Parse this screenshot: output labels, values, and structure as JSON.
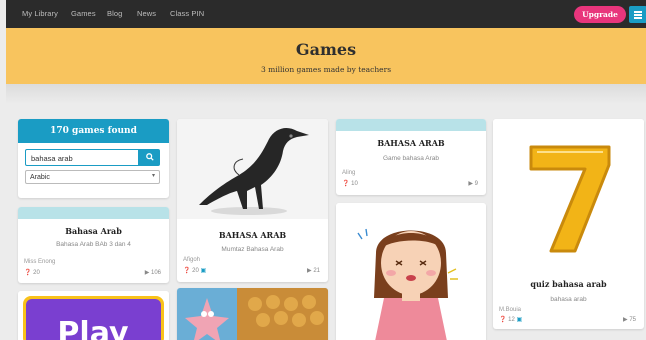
{
  "nav": {
    "links": [
      "My Library",
      "Games",
      "Blog",
      "News",
      "Class PIN"
    ],
    "upgrade_label": "Upgrade"
  },
  "hero": {
    "title": "Games",
    "subtitle": "3 million games made by teachers"
  },
  "filter": {
    "found_label": "170 games found",
    "search_value": "bahasa arab",
    "language_value": "Arabic"
  },
  "cards": [
    {
      "title": "Bahasa Arab",
      "subtitle": "Bahasa Arab BAb 3 dan 4",
      "author": "Miss Enong",
      "stat": "20",
      "plays": "106",
      "image": "none"
    },
    {
      "title": "BAHASA ARAB",
      "subtitle": "Mumtaz Bahasa Arab",
      "author": "Afigoh",
      "stat": "20",
      "plays": "21",
      "image": "crow"
    },
    {
      "title": "BAHASA ARAB",
      "subtitle": "Game bahasa Arab",
      "author": "Aling",
      "stat": "10",
      "plays": "9",
      "image": "none"
    },
    {
      "title": "quiz bahasa arab",
      "subtitle": "bahasa arab",
      "author": "M.Bouia",
      "stat": "12",
      "plays": "75",
      "image": "number-seven"
    },
    {
      "title": "Play",
      "image": "play-banner"
    },
    {
      "image": "cartoon-starfish"
    },
    {
      "image": "cartoon-girl"
    }
  ],
  "colors": {
    "accent": "#1a9cc4",
    "upgrade": "#e8357c",
    "hero_bg": "#f8c45e",
    "nav_bg": "#2b2b2b"
  }
}
